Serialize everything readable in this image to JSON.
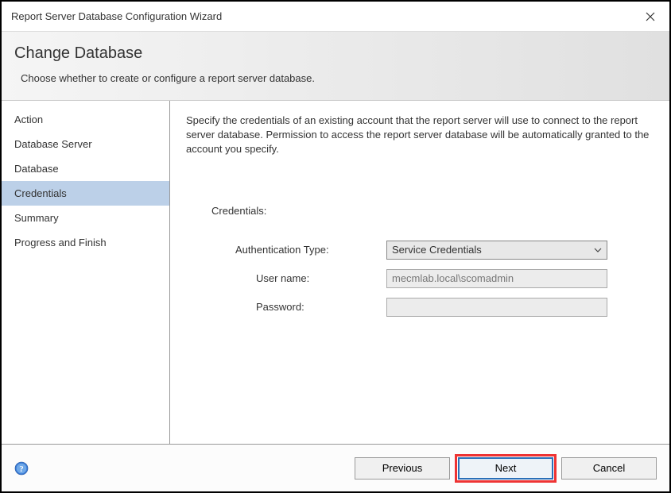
{
  "window": {
    "title": "Report Server Database Configuration Wizard"
  },
  "header": {
    "title": "Change Database",
    "subtitle": "Choose whether to create or configure a report server database."
  },
  "sidebar": {
    "items": [
      {
        "label": "Action",
        "selected": false
      },
      {
        "label": "Database Server",
        "selected": false
      },
      {
        "label": "Database",
        "selected": false
      },
      {
        "label": "Credentials",
        "selected": true
      },
      {
        "label": "Summary",
        "selected": false
      },
      {
        "label": "Progress and Finish",
        "selected": false
      }
    ]
  },
  "main": {
    "description": "Specify the credentials of an existing account that the report server will use to connect to the report server database.  Permission to access the report server database will be automatically granted to the account you specify.",
    "section_label": "Credentials:",
    "form": {
      "auth_type_label": "Authentication Type:",
      "auth_type_value": "Service Credentials",
      "username_label": "User name:",
      "username_value": "mecmlab.local\\scomadmin",
      "password_label": "Password:",
      "password_value": ""
    }
  },
  "footer": {
    "previous": "Previous",
    "next": "Next",
    "cancel": "Cancel"
  }
}
